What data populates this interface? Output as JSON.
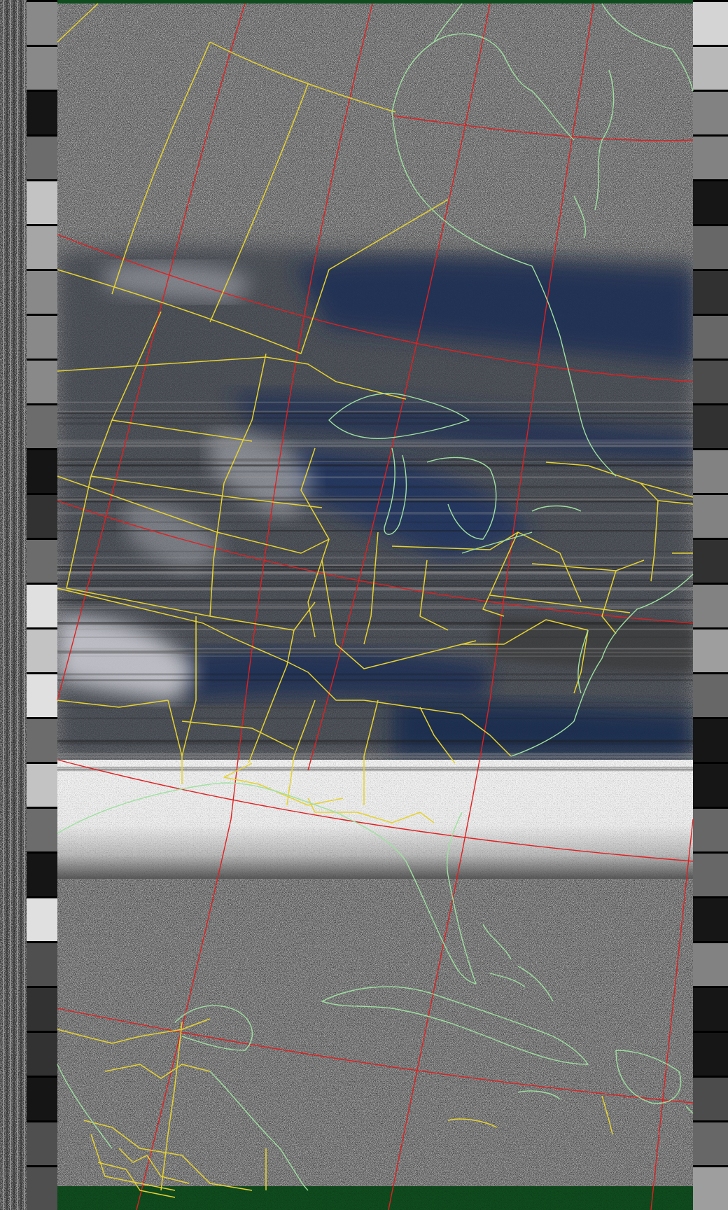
{
  "image": {
    "kind": "NOAA APT weather satellite image with map overlay",
    "colors": {
      "noise_dark": "#2a2a2a",
      "noise_light": "#cfcfcf",
      "cloud_blue": "#1a2c52",
      "cloud_white": "#e8e8ee",
      "land_dark": "#383838",
      "sync_strip": "#3a3a3a",
      "green_bar": "#0f4d1e",
      "graticule": "#e02020",
      "state_borders": "#e6d230",
      "coastlines": "#9fe0a0"
    }
  },
  "layers": [
    {
      "name": "satellite-imagery",
      "visible": true
    },
    {
      "name": "graticule",
      "visible": true
    },
    {
      "name": "state-borders",
      "visible": true
    },
    {
      "name": "coastlines",
      "visible": true
    }
  ]
}
